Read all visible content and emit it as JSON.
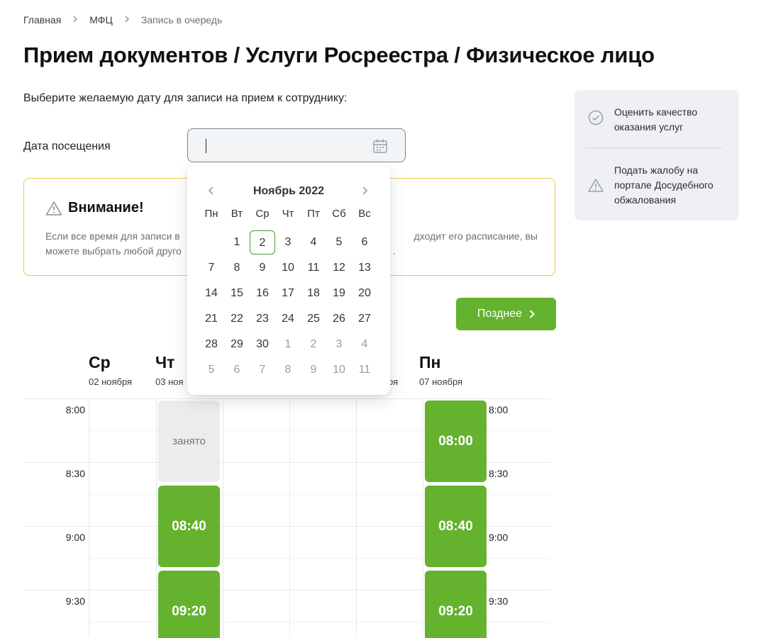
{
  "breadcrumb": {
    "items": [
      "Главная",
      "МФЦ"
    ],
    "current": "Запись в очередь"
  },
  "page": {
    "title": "Прием документов / Услуги Росреестра / Физическое лицо",
    "subtitle": "Выберите желаемую дату для записи на прием к сотруднику:"
  },
  "date_field": {
    "label": "Дата посещения",
    "value": "",
    "icon": "calendar-icon"
  },
  "sidebar": {
    "items": [
      {
        "label": "Оценить качество оказания услуг",
        "icon": "check-circle-icon"
      },
      {
        "label": "Подать жалобу на портале Досудебного обжалования",
        "icon": "warning-icon"
      }
    ]
  },
  "alert": {
    "title": "Внимание!",
    "text_left_1": "Если все время для записи в",
    "text_left_2": "можете выбрать любой друго",
    "text_right_1": "дходит его расписание, вы",
    "text_right_2": "."
  },
  "later_button": {
    "label": "Позднее"
  },
  "schedule": {
    "days": [
      {
        "name": "Ср",
        "date": "02 ноября"
      },
      {
        "name": "Чт",
        "date": "03 ноя"
      },
      {
        "name": "",
        "date": "ря"
      },
      {
        "name": "Пн",
        "date": "07 ноября"
      }
    ],
    "times": [
      "8:00",
      "8:30",
      "9:00",
      "9:30"
    ],
    "busy_label": "занято",
    "thursday_slots": [
      "08:40",
      "09:20"
    ],
    "monday_slots": [
      "08:00",
      "08:40",
      "09:20"
    ]
  },
  "calendar": {
    "month": "Ноябрь 2022",
    "weekdays": [
      "Пн",
      "Вт",
      "Ср",
      "Чт",
      "Пт",
      "Сб",
      "Вс"
    ],
    "selected_day": "2",
    "days": [
      [
        "",
        "1",
        "2",
        "3",
        "4",
        "5",
        "6"
      ],
      [
        "7",
        "8",
        "9",
        "10",
        "11",
        "12",
        "13"
      ],
      [
        "14",
        "15",
        "16",
        "17",
        "18",
        "19",
        "20"
      ],
      [
        "21",
        "22",
        "23",
        "24",
        "25",
        "26",
        "27"
      ],
      [
        "28",
        "29",
        "30",
        "1",
        "2",
        "3",
        "4"
      ],
      [
        "5",
        "6",
        "7",
        "8",
        "9",
        "10",
        "11"
      ]
    ]
  },
  "colors": {
    "accent": "#64b22e",
    "alert_border": "#e8cb4a",
    "side_bg": "#eef0f3"
  }
}
